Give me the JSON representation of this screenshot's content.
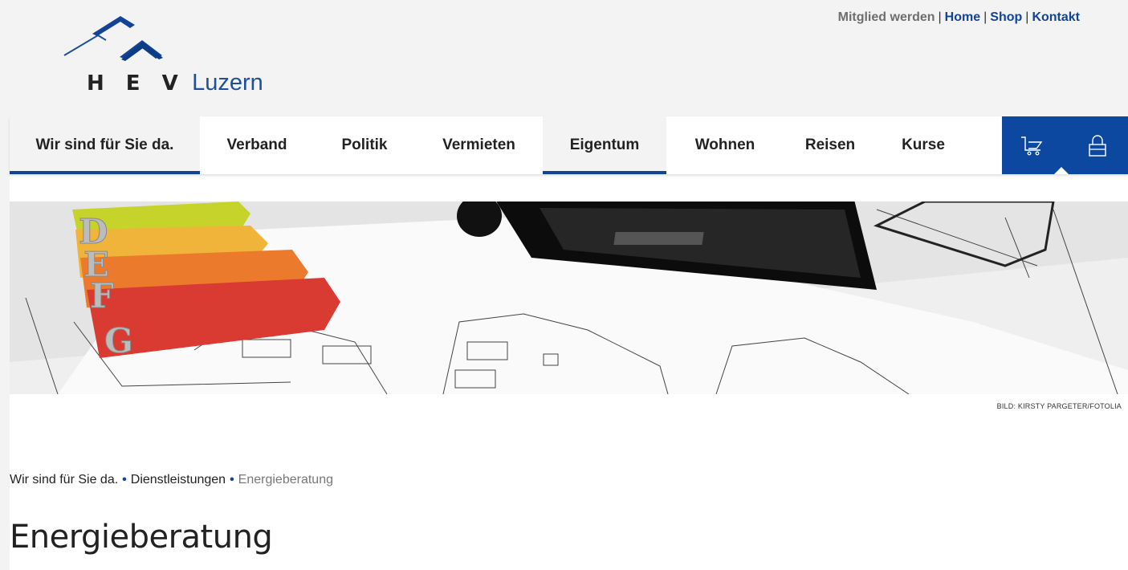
{
  "brand": {
    "hev": "H E V",
    "luzern": "Luzern",
    "color_primary": "#134397",
    "color_bar": "#0d48a0"
  },
  "topnav": {
    "member": "Mitglied werden",
    "home": "Home",
    "shop": "Shop",
    "contact": "Kontakt",
    "separator": "|"
  },
  "mainnav": {
    "items": [
      {
        "label": "Wir sind für Sie da.",
        "active": true
      },
      {
        "label": "Verband",
        "active": false
      },
      {
        "label": "Politik",
        "active": false
      },
      {
        "label": "Vermieten",
        "active": false
      },
      {
        "label": "Eigentum",
        "active": true
      },
      {
        "label": "Wohnen",
        "active": false
      },
      {
        "label": "Reisen",
        "active": false
      },
      {
        "label": "Kurse",
        "active": false
      }
    ],
    "tools": [
      {
        "icon": "cart-icon"
      },
      {
        "icon": "lock-icon"
      }
    ]
  },
  "hero": {
    "labels": [
      "D",
      "E",
      "F",
      "G"
    ],
    "credit": "BILD: KIRSTY PARGETER/FOTOLIA"
  },
  "breadcrumb": {
    "items": [
      "Wir sind für Sie da.",
      "Dienstleistungen",
      "Energieberatung"
    ],
    "separator": "•"
  },
  "page": {
    "title": "Energieberatung"
  }
}
